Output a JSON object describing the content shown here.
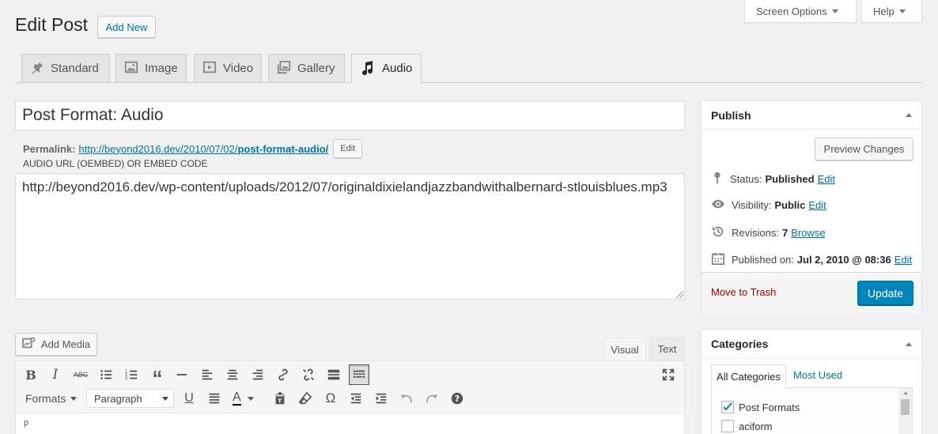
{
  "page": {
    "title": "Edit Post",
    "add_new": "Add New"
  },
  "top_tabs": {
    "screen_options": "Screen Options",
    "help": "Help"
  },
  "format_tabs": [
    {
      "label": "Standard",
      "icon": "pin-icon"
    },
    {
      "label": "Image",
      "icon": "image-icon"
    },
    {
      "label": "Video",
      "icon": "video-icon"
    },
    {
      "label": "Gallery",
      "icon": "gallery-icon"
    },
    {
      "label": "Audio",
      "icon": "music-icon",
      "active": true
    }
  ],
  "post": {
    "title": "Post Format: Audio",
    "permalink_label": "Permalink:",
    "permalink_base": "http://beyond2016.dev/2010/07/02/",
    "permalink_slug": "post-format-audio/",
    "permalink_edit": "Edit",
    "audio_label": "AUDIO URL (OEMBED) OR EMBED CODE",
    "audio_value": "http://beyond2016.dev/wp-content/uploads/2012/07/originaldixielandjazzbandwithalbernard-stlouisblues.mp3"
  },
  "editor": {
    "add_media": "Add Media",
    "tab_visual": "Visual",
    "tab_text": "Text",
    "formats": "Formats",
    "paragraph": "Paragraph",
    "path": "p",
    "row1_icons": [
      "bold-icon",
      "italic-icon",
      "strikethrough-icon",
      "bullet-list-icon",
      "numbered-list-icon",
      "blockquote-icon",
      "horizontal-rule-icon",
      "align-left-icon",
      "align-center-icon",
      "align-right-icon",
      "link-icon",
      "unlink-icon",
      "read-more-icon",
      "toolbar-toggle-icon"
    ],
    "row2_icons": [
      "underline-icon",
      "justify-icon",
      "text-color-icon",
      "paste-text-icon",
      "clear-formatting-icon",
      "special-character-icon",
      "outdent-icon",
      "indent-icon",
      "undo-icon",
      "redo-icon",
      "help-icon"
    ]
  },
  "publish": {
    "title": "Publish",
    "preview": "Preview Changes",
    "status_label": "Status:",
    "status_value": "Published",
    "status_edit": "Edit",
    "visibility_label": "Visibility:",
    "visibility_value": "Public",
    "visibility_edit": "Edit",
    "revisions_label": "Revisions:",
    "revisions_value": "7",
    "revisions_browse": "Browse",
    "published_label": "Published on:",
    "published_value": "Jul 2, 2010 @ 08:36",
    "published_edit": "Edit",
    "trash": "Move to Trash",
    "update": "Update"
  },
  "categories": {
    "title": "Categories",
    "tab_all": "All Categories",
    "tab_most_used": "Most Used",
    "items": [
      {
        "label": "Post Formats",
        "checked": true
      },
      {
        "label": "aciform",
        "checked": false
      }
    ]
  },
  "colors": {
    "accent": "#0073aa",
    "update_button": "#0085ba",
    "trash": "#a00"
  }
}
